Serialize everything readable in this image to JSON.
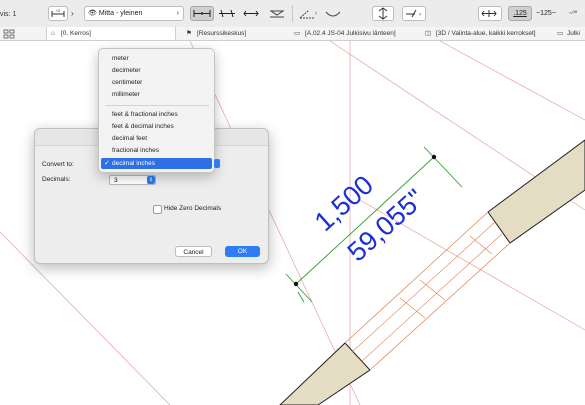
{
  "toolbar": {
    "left_clip": "vis: 1",
    "arrow_style_icon": "arrow-style-icon",
    "view_name": "Mitta - yleinen",
    "scale_values": [
      ".125",
      "~125~"
    ]
  },
  "tabs": [
    {
      "label": "[0. Kerros]"
    },
    {
      "label": "[Resurssikeskus]"
    },
    {
      "label": "[A.02.4 JS-04 Julkisivu länteen]"
    },
    {
      "label": "[3D / Valinta-alue, kaikki kerrokset]"
    },
    {
      "label": "Julki"
    }
  ],
  "dialog": {
    "convert_to_label": "Convert to:",
    "decimals_label": "Decimals:",
    "decimals_value": "3",
    "hide_zero_label": "Hide Zero Decimals",
    "hide_zero_checked": false,
    "cancel_label": "Cancel",
    "ok_label": "OK"
  },
  "menu": {
    "items": [
      {
        "label": "meter",
        "selected": false
      },
      {
        "label": "decimeter",
        "selected": false
      },
      {
        "label": "centimeter",
        "selected": false
      },
      {
        "label": "millimeter",
        "selected": false
      },
      {
        "label": "feet & fractional inches",
        "selected": false
      },
      {
        "label": "feet & decimal inches",
        "selected": false
      },
      {
        "label": "decimal feet",
        "selected": false
      },
      {
        "label": "fractional inches",
        "selected": false
      },
      {
        "label": "decimal inches",
        "selected": true
      }
    ],
    "check_glyph": "✓"
  },
  "dimension": {
    "primary": "1,500",
    "secondary": "59,055\""
  },
  "colors": {
    "accent": "#2f7df6",
    "dimension_text": "#1a2fd6",
    "dimension_line": "#2e9e2e",
    "guide_line": "#e6a0a0",
    "wall_fill": "#e4dcc3"
  }
}
